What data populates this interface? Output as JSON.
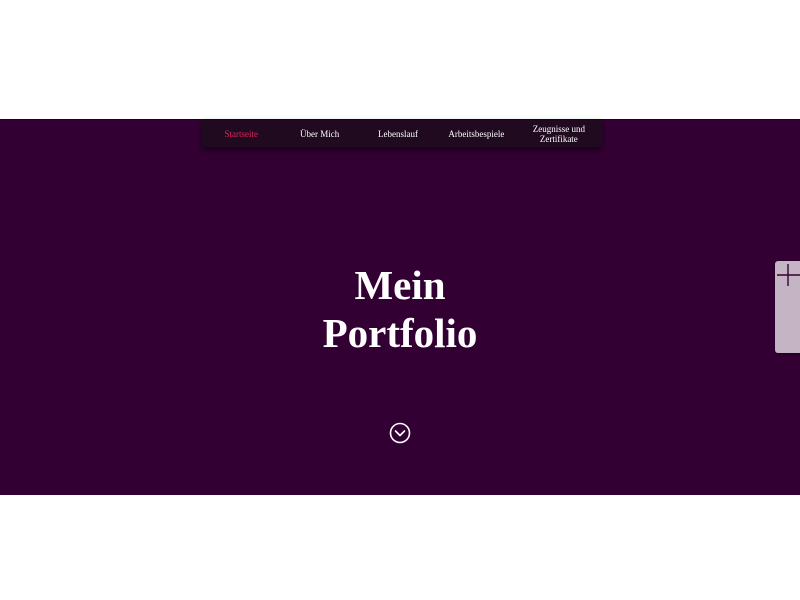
{
  "navigation": {
    "items": [
      {
        "label": "Startseite",
        "active": true
      },
      {
        "label": "Über Mich",
        "active": false
      },
      {
        "label": "Lebenslauf",
        "active": false
      },
      {
        "label": "Arbeitsbespiele",
        "active": false
      },
      {
        "label": "Zeugnisse und Zertifikate",
        "active": false
      }
    ]
  },
  "hero": {
    "title_line1": "Mein",
    "title_line2": "Portfolio",
    "scroll_icon": "chevron-down-circle-icon"
  },
  "side_tab": {
    "icon": "plus-icon"
  },
  "colors": {
    "hero_background": "#330033",
    "navbar_background": "#1f0a1f",
    "active_nav": "#e0245e",
    "side_tab": "#c4b4c4"
  }
}
